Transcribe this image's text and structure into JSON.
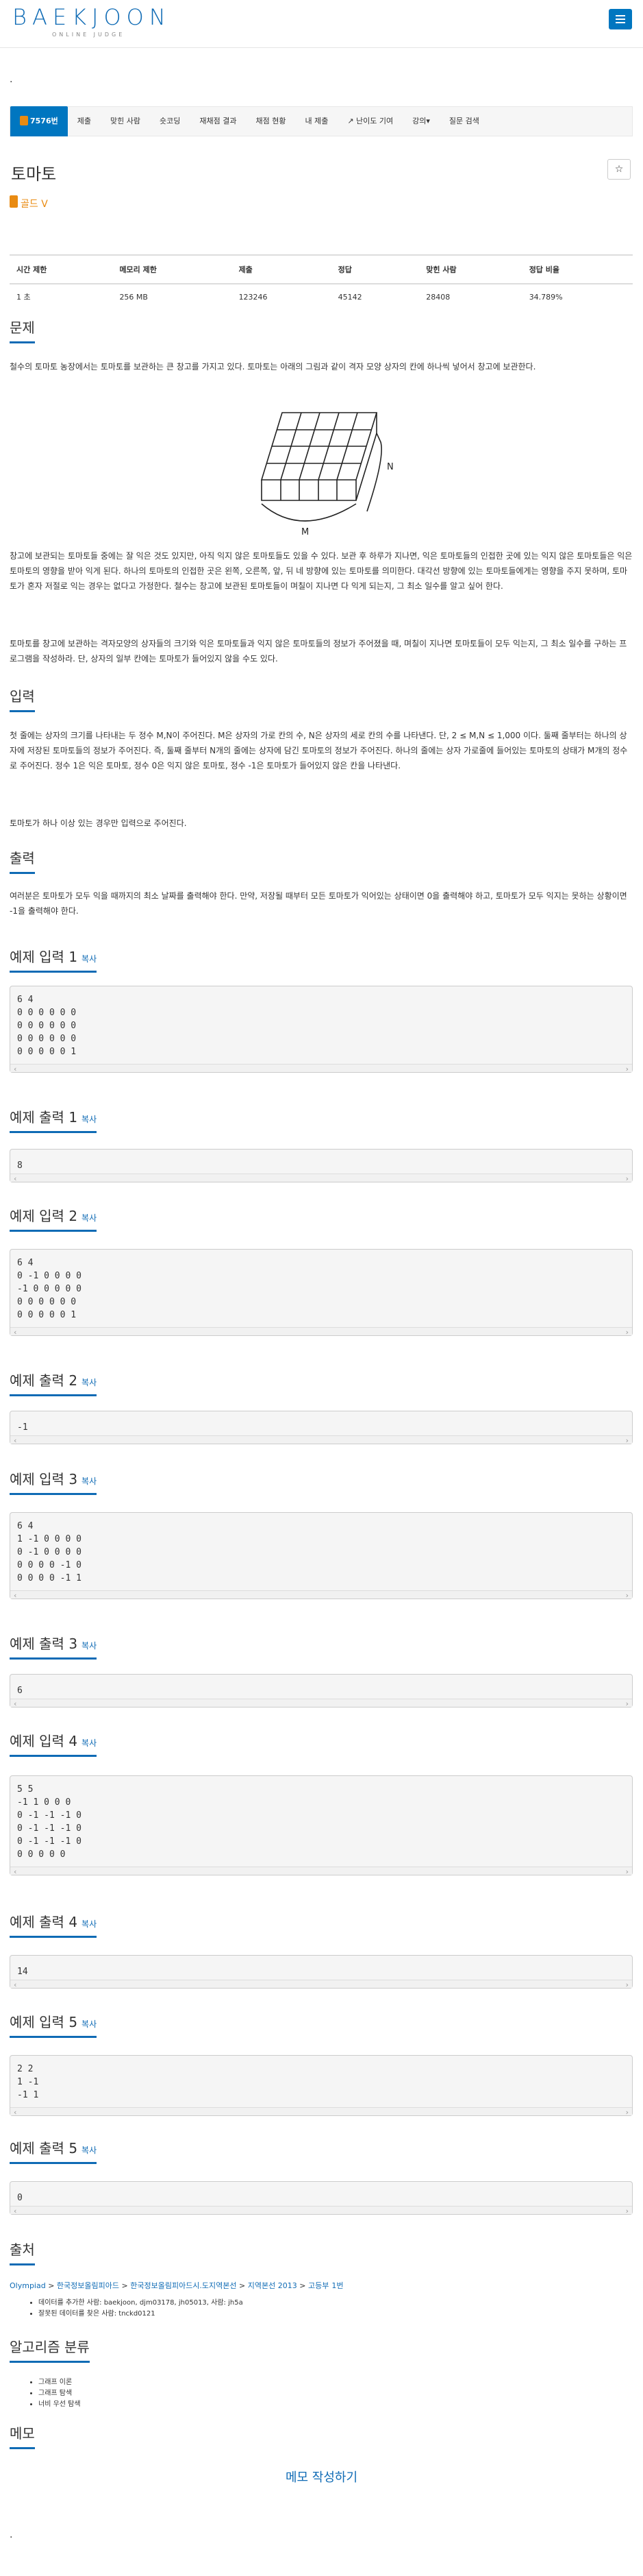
{
  "header": {
    "logo": "BAEKJOON",
    "logo_sub": "ONLINE JUDGE",
    "menu_icon": "hamburger-icon"
  },
  "misc": {
    "dot1": ".",
    "dot2": "."
  },
  "tabs": [
    "7576번",
    "제출",
    "맞힌 사람",
    "숏코딩",
    "재채점 결과",
    "채점 현황",
    "내 제출",
    "난이도 기여",
    "강의▾",
    "질문 검색"
  ],
  "problem": {
    "title": "토마토",
    "tier": "골드 V",
    "star": "☆"
  },
  "stats": {
    "headers": [
      "시간 제한",
      "메모리 제한",
      "제출",
      "정답",
      "맞힌 사람",
      "정답 비율"
    ],
    "values": [
      "1 초",
      "256 MB",
      "123246",
      "45142",
      "28408",
      "34.789%"
    ]
  },
  "sections": {
    "problem_label": "문제",
    "problem_p1": "철수의 토마토 농장에서는 토마토를 보관하는 큰 창고를 가지고 있다. 토마토는 아래의 그림과 같이 격자 모양 상자의 칸에 하나씩 넣어서 창고에 보관한다.",
    "fig_n": "N",
    "fig_m": "M",
    "problem_p2": "창고에 보관되는 토마토들 중에는 잘 익은 것도 있지만, 아직 익지 않은 토마토들도 있을 수 있다. 보관 후 하루가 지나면, 익은 토마토들의 인접한 곳에 있는 익지 않은 토마토들은 익은 토마토의 영향을 받아 익게 된다. 하나의 토마토의 인접한 곳은 왼쪽, 오른쪽, 앞, 뒤 네 방향에 있는 토마토를 의미한다. 대각선 방향에 있는 토마토들에게는 영향을 주지 못하며, 토마토가 혼자 저절로 익는 경우는 없다고 가정한다. 철수는 창고에 보관된 토마토들이 며칠이 지나면 다 익게 되는지, 그 최소 일수를 알고 싶어 한다.",
    "problem_p3": "토마토를 창고에 보관하는 격자모양의 상자들의 크기와 익은 토마토들과 익지 않은 토마토들의 정보가 주어졌을 때, 며칠이 지나면 토마토들이 모두 익는지, 그 최소 일수를 구하는 프로그램을 작성하라. 단, 상자의 일부 칸에는 토마토가 들어있지 않을 수도 있다.",
    "input_label": "입력",
    "input_p1": "첫 줄에는 상자의 크기를 나타내는 두 정수 M,N이 주어진다. M은 상자의 가로 칸의 수, N은 상자의 세로 칸의 수를 나타낸다. 단, 2 ≤ M,N ≤ 1,000 이다. 둘째 줄부터는 하나의 상자에 저장된 토마토들의 정보가 주어진다. 즉, 둘째 줄부터 N개의 줄에는 상자에 담긴 토마토의 정보가 주어진다. 하나의 줄에는 상자 가로줄에 들어있는 토마토의 상태가 M개의 정수로 주어진다. 정수 1은 익은 토마토, 정수 0은 익지 않은 토마토, 정수 -1은 토마토가 들어있지 않은 칸을 나타낸다.",
    "input_p2": "토마토가 하나 이상 있는 경우만 입력으로 주어진다.",
    "output_label": "출력",
    "output_p1": "여러분은 토마토가 모두 익을 때까지의 최소 날짜를 출력해야 한다. 만약, 저장될 때부터 모든 토마토가 익어있는 상태이면 0을 출력해야 하고, 토마토가 모두 익지는 못하는 상황이면 -1을 출력해야 한다.",
    "copy": "복사",
    "ex_in": [
      "예제 입력 1",
      "예제 입력 2",
      "예제 입력 3",
      "예제 입력 4",
      "예제 입력 5"
    ],
    "ex_out": [
      "예제 출력 1",
      "예제 출력 2",
      "예제 출력 3",
      "예제 출력 4",
      "예제 출력 5"
    ],
    "source_label": "출처",
    "algo_label": "알고리즘 분류",
    "memo_label": "메모"
  },
  "examples": {
    "in": [
      "6 4\n0 0 0 0 0 0\n0 0 0 0 0 0\n0 0 0 0 0 0\n0 0 0 0 0 1",
      "6 4\n0 -1 0 0 0 0\n-1 0 0 0 0 0\n0 0 0 0 0 0\n0 0 0 0 0 1",
      "6 4\n1 -1 0 0 0 0\n0 -1 0 0 0 0\n0 0 0 0 -1 0\n0 0 0 0 -1 1",
      "5 5\n-1 1 0 0 0\n0 -1 -1 -1 0\n0 -1 -1 -1 0\n0 -1 -1 -1 0\n0 0 0 0 0",
      "2 2\n1 -1\n-1 1"
    ],
    "out": [
      "8",
      "-1",
      "6",
      "14",
      "0"
    ]
  },
  "source": {
    "path": [
      "Olympiad",
      "한국정보올림피아드",
      "한국정보올림피아드시.도지역본선",
      "지역본선 2013",
      "고등부",
      "1번"
    ],
    "sep": " > ",
    "items": [
      "데이터를 추가한 사람: baekjoon, djm03178, jh05013, 사람: jh5a",
      "잘못된 데이터를 찾은 사람: tnckd0121"
    ]
  },
  "algorithms": [
    "그래프 이론",
    "그래프 탐색",
    "너비 우선 탐색"
  ],
  "memo": {
    "button": "메모 작성하기"
  }
}
